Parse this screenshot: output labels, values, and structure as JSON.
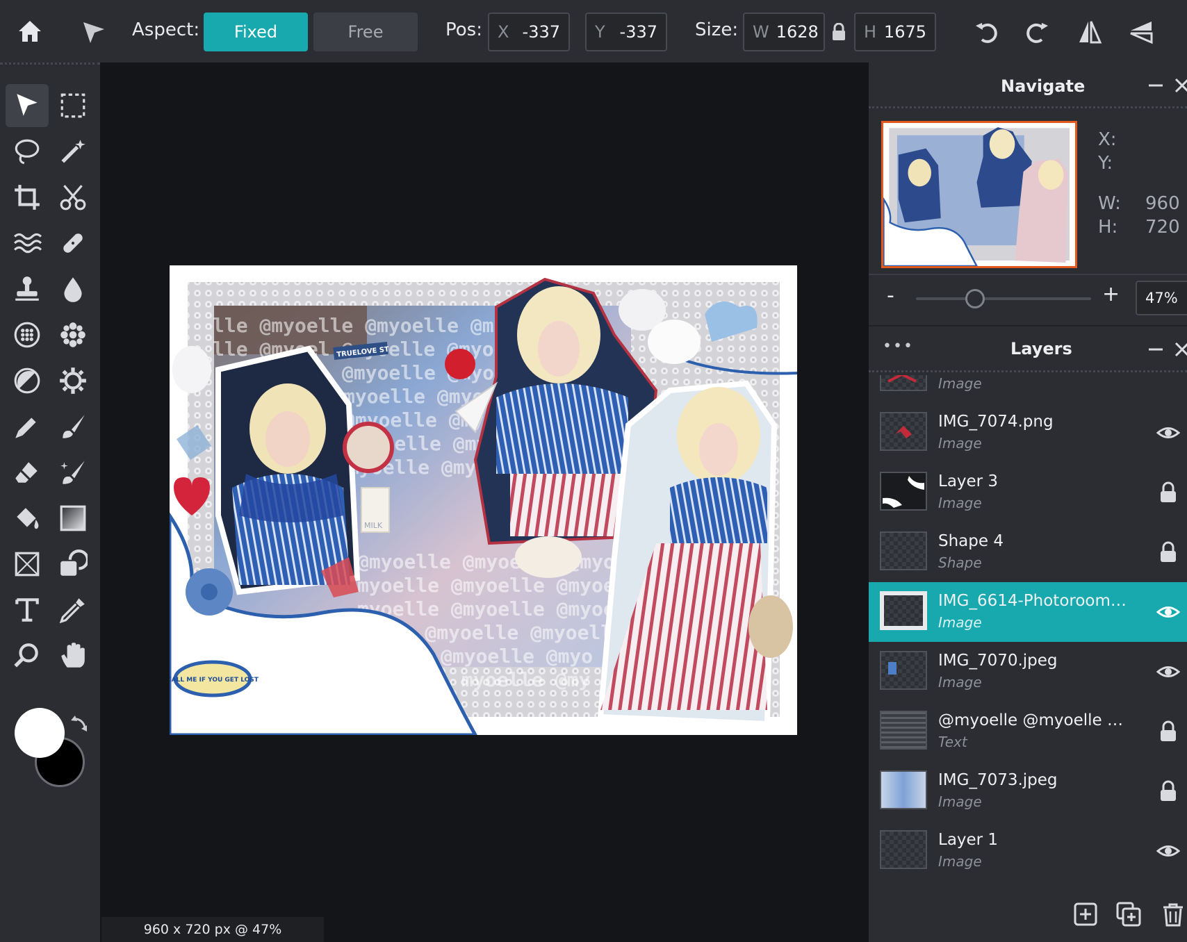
{
  "toolbar": {
    "aspect_label": "Aspect:",
    "aspect_fixed": "Fixed",
    "aspect_free": "Free",
    "pos_label": "Pos:",
    "pos_x_key": "X",
    "pos_x": "-337",
    "pos_y_key": "Y",
    "pos_y": "-337",
    "size_label": "Size:",
    "size_w_key": "W",
    "size_w": "1628",
    "size_h_key": "H",
    "size_h": "1675"
  },
  "tools": [
    "move-tool",
    "marquee-tool",
    "lasso-tool",
    "magic-wand-tool",
    "crop-tool",
    "cut-tool",
    "liquify-tool",
    "heal-tool",
    "stamp-tool",
    "blur-tool",
    "sponge-tool",
    "details-tool",
    "dodge-burn-tool",
    "color-adjust-tool",
    "pencil-tool",
    "brush-tool",
    "eraser-tool",
    "smart-brush-tool",
    "fill-tool",
    "gradient-tool",
    "shape-tool",
    "copy-tool",
    "text-tool",
    "eyedropper-tool",
    "zoom-tool",
    "hand-tool"
  ],
  "colors": {
    "accent": "#17a9ad",
    "foreground": "#ffffff",
    "background": "#000000",
    "panel": "#2b2d32"
  },
  "canvas": {
    "status": "960 x 720 px @ 47%"
  },
  "navigate": {
    "title": "Navigate",
    "x_label": "X:",
    "y_label": "Y:",
    "w_label": "W:",
    "w_value": "960",
    "h_label": "H:",
    "h_value": "720",
    "zoom_minus": "-",
    "zoom_plus": "+",
    "zoom_value": "47%",
    "zoom_fraction": 0.47
  },
  "layers": {
    "title": "Layers",
    "menu": "•••",
    "items": [
      {
        "name": "",
        "type": "Image",
        "state": "visible",
        "selected": false
      },
      {
        "name": "IMG_7074.png",
        "type": "Image",
        "state": "visible",
        "selected": false
      },
      {
        "name": "Layer 3",
        "type": "Image",
        "state": "locked",
        "selected": false
      },
      {
        "name": "Shape 4",
        "type": "Shape",
        "state": "locked",
        "selected": false
      },
      {
        "name": "IMG_6614-Photoroom…",
        "type": "Image",
        "state": "visible",
        "selected": true
      },
      {
        "name": "IMG_7070.jpeg",
        "type": "Image",
        "state": "visible",
        "selected": false
      },
      {
        "name": "@myoelle @myoelle …",
        "type": "Text",
        "state": "locked",
        "selected": false
      },
      {
        "name": "IMG_7073.jpeg",
        "type": "Image",
        "state": "locked",
        "selected": false
      },
      {
        "name": "Layer 1",
        "type": "Image",
        "state": "visible",
        "selected": false
      }
    ]
  },
  "artwork": {
    "watermark_lines": [
      "lle @myoelle @myoelle @my",
      "lle @myoel @myoelle @myoelle",
      "@myoelle @myoelle @my",
      "myoelle @myoelle @my",
      "@myoelle @myoelle @my",
      "@myoelle @myoelle @my",
      "myoelle @myoelle @myoelle",
      "@myoelle @myoelle @myoelle @",
      "myoelle @myoelle @myoelle @",
      "myoelle @myoelle @myoelle @",
      "lle @myoelle @myoell",
      "@myoelle @myo",
      "myoelle @my"
    ],
    "street_sign": "TRUELOVE ST",
    "badge_text": "CALL ME IF YOU GET LOST",
    "milk_label": "MILK"
  }
}
